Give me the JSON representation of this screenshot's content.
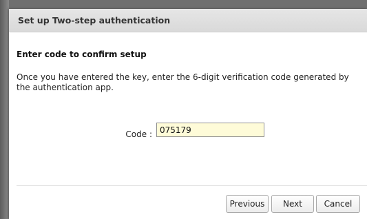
{
  "dialog": {
    "title": "Set up Two-step authentication",
    "heading": "Enter code to confirm setup",
    "instructions": "Once you have entered the key, enter the 6-digit verification code generated by the authentication app.",
    "code_label": "Code :",
    "code_value": "075179",
    "buttons": {
      "previous": "Previous",
      "next": "Next",
      "cancel": "Cancel"
    }
  },
  "colors": {
    "header_bg": "#dddddd",
    "input_bg": "#fefbd8",
    "backdrop": "#6f6f6f"
  }
}
